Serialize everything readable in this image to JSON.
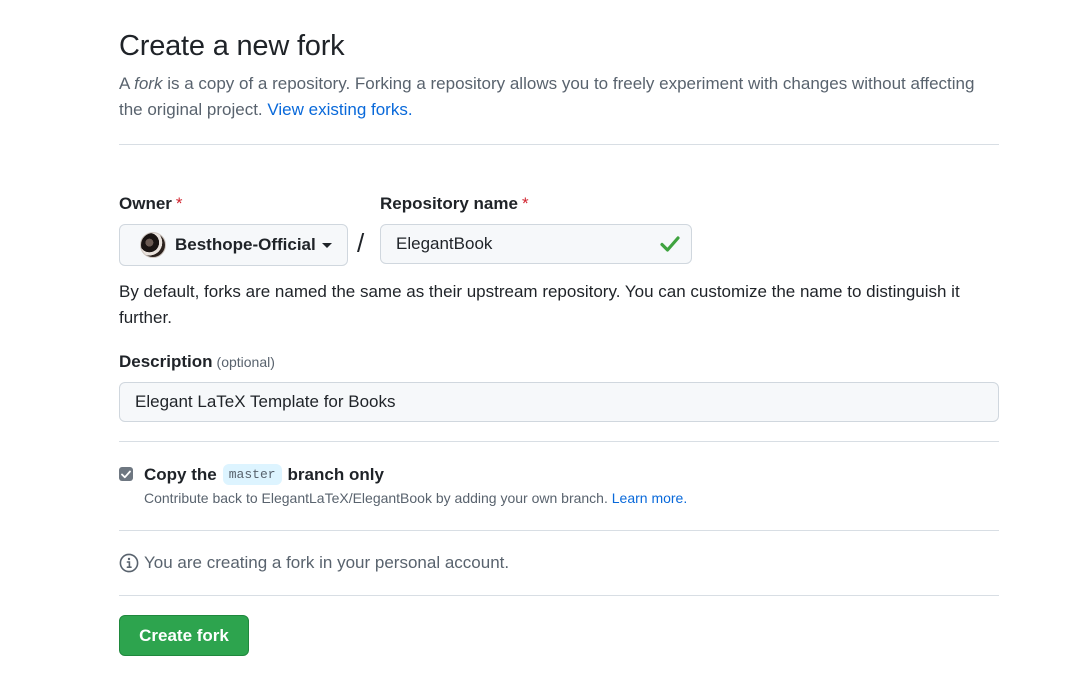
{
  "header": {
    "title": "Create a new fork",
    "subtitle_a": "A ",
    "subtitle_fork": "fork",
    "subtitle_b": " is a copy of a repository. Forking a repository allows you to freely experiment with changes without affecting the original project. ",
    "view_forks_link": "View existing forks."
  },
  "owner": {
    "label": "Owner",
    "required_mark": "*",
    "selected": "Besthope-Official"
  },
  "repository": {
    "label": "Repository name",
    "required_mark": "*",
    "separator": "/",
    "value": "ElegantBook",
    "valid_icon": "check-icon",
    "hint": "By default, forks are named the same as their upstream repository. You can customize the name to distinguish it further."
  },
  "description": {
    "label": "Description",
    "optional": "(optional)",
    "value": "Elegant LaTeX Template for Books"
  },
  "copy_branch": {
    "checked": true,
    "label_a": "Copy the",
    "branch": "master",
    "label_b": "branch only",
    "note": "Contribute back to ElegantLaTeX/ElegantBook by adding your own branch. ",
    "learn_more": "Learn more."
  },
  "info": {
    "icon": "info-icon",
    "text": "You are creating a fork in your personal account."
  },
  "actions": {
    "create_label": "Create fork"
  },
  "colors": {
    "primary_button": "#2da44e",
    "link": "#0969da",
    "required": "#d1242f",
    "success": "#3fa33f"
  }
}
